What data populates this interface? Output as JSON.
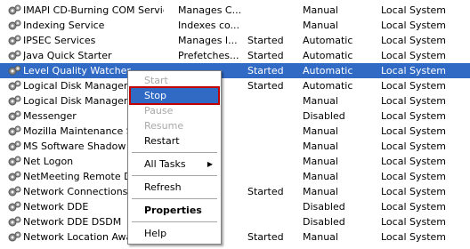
{
  "services": [
    {
      "name": "IMAPI CD-Burning COM Service",
      "desc": "Manages C...",
      "status": "",
      "startup": "Manual",
      "logon": "Local System"
    },
    {
      "name": "Indexing Service",
      "desc": "Indexes co...",
      "status": "",
      "startup": "Manual",
      "logon": "Local System"
    },
    {
      "name": "IPSEC Services",
      "desc": "Manages I...",
      "status": "Started",
      "startup": "Automatic",
      "logon": "Local System"
    },
    {
      "name": "Java Quick Starter",
      "desc": "Prefetches...",
      "status": "Started",
      "startup": "Automatic",
      "logon": "Local System"
    },
    {
      "name": "Level Quality Watcher",
      "desc": "",
      "status": "Started",
      "startup": "Automatic",
      "logon": "Local System",
      "selected": true
    },
    {
      "name": "Logical Disk Manager",
      "desc": "...",
      "status": "Started",
      "startup": "Automatic",
      "logon": "Local System"
    },
    {
      "name": "Logical Disk Manager Ad",
      "desc": "",
      "status": "",
      "startup": "Manual",
      "logon": "Local System"
    },
    {
      "name": "Messenger",
      "desc": "",
      "status": "",
      "startup": "Disabled",
      "logon": "Local System"
    },
    {
      "name": "Mozilla Maintenance Serv",
      "desc": "",
      "status": "",
      "startup": "Manual",
      "logon": "Local System"
    },
    {
      "name": "MS Software Shadow Co",
      "desc": "",
      "status": "",
      "startup": "Manual",
      "logon": "Local System"
    },
    {
      "name": "Net Logon",
      "desc": "",
      "status": "",
      "startup": "Manual",
      "logon": "Local System"
    },
    {
      "name": "NetMeeting Remote Des",
      "desc": "",
      "status": "",
      "startup": "Manual",
      "logon": "Local System"
    },
    {
      "name": "Network Connections",
      "desc": "",
      "status": "Started",
      "startup": "Manual",
      "logon": "Local System"
    },
    {
      "name": "Network DDE",
      "desc": "",
      "status": "",
      "startup": "Disabled",
      "logon": "Local System"
    },
    {
      "name": "Network DDE DSDM",
      "desc": "",
      "status": "",
      "startup": "Disabled",
      "logon": "Local System"
    },
    {
      "name": "Network Location Aware",
      "desc": "",
      "status": "Started",
      "startup": "Manual",
      "logon": "Local System"
    }
  ],
  "context_menu": {
    "start": "Start",
    "stop": "Stop",
    "pause": "Pause",
    "resume": "Resume",
    "restart": "Restart",
    "all_tasks": "All Tasks",
    "refresh": "Refresh",
    "properties": "Properties",
    "help": "Help"
  },
  "colors": {
    "selection": "#316ac5",
    "highlight_border": "#c00000"
  }
}
